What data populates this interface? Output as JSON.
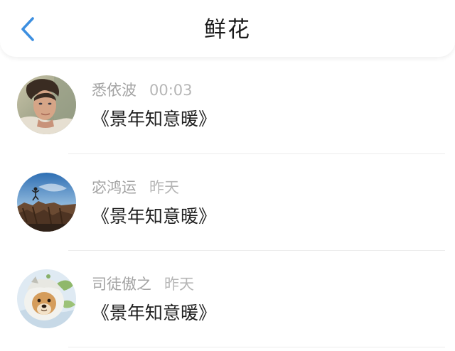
{
  "header": {
    "title": "鲜花",
    "back_icon": "chevron-left-icon",
    "back_color": "#3d8fe0"
  },
  "feed": {
    "items": [
      {
        "username": "悉依波",
        "time": "00:03",
        "content": "《景年知意暖》",
        "avatar": "man-portrait-avatar"
      },
      {
        "username": "宓鸿运",
        "time": "昨天",
        "content": "《景年知意暖》",
        "avatar": "cliff-landscape-avatar"
      },
      {
        "username": "司徒傲之",
        "time": "昨天",
        "content": "《景年知意暖》",
        "avatar": "shiba-dog-avatar"
      }
    ]
  }
}
